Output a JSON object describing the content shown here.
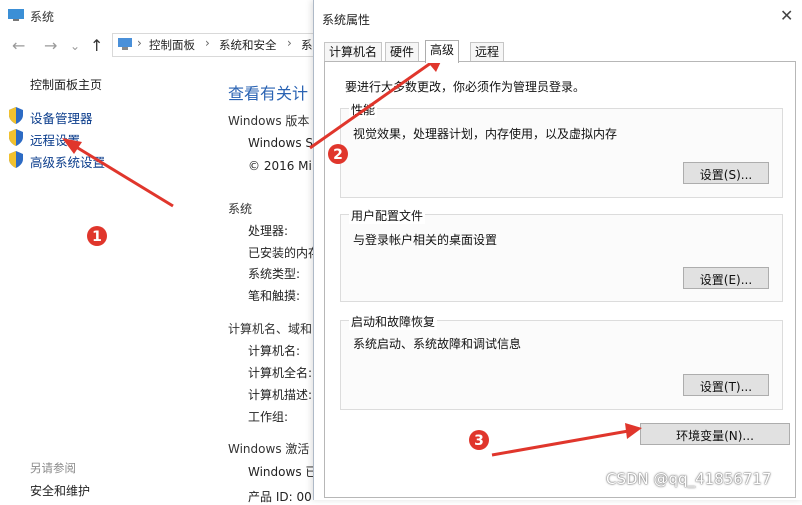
{
  "background_window": {
    "title": "系统",
    "breadcrumb": [
      "控制面板",
      "系统和安全",
      "系"
    ],
    "left_panel": {
      "home": "控制面板主页",
      "links": [
        "设备管理器",
        "远程设置",
        "高级系统设置"
      ],
      "see_also": "另请参阅",
      "security": "安全和维护"
    },
    "main": {
      "heading": "查看有关计",
      "windows_edition": "Windows 版本",
      "windows_name": "Windows S",
      "copyright": "© 2016 Mi",
      "system_section": "系统",
      "system_rows": [
        "处理器:",
        "已安装的内存",
        "系统类型:",
        "笔和触摸:"
      ],
      "computer_section": "计算机名、域和",
      "computer_rows": [
        "计算机名:",
        "计算机全名:",
        "计算机描述:",
        "工作组:"
      ],
      "activation_section": "Windows 激活",
      "activation_row": "Windows 已",
      "product_id": "产品 ID: 00"
    }
  },
  "dialog": {
    "title": "系统属性",
    "close": "✕",
    "tabs": [
      "计算机名",
      "硬件",
      "高级",
      "远程"
    ],
    "selected_tab": "高级",
    "admin_note": "要进行大多数更改，你必须作为管理员登录。",
    "groups": [
      {
        "title": "性能",
        "desc": "视觉效果，处理器计划，内存使用，以及虚拟内存",
        "button": "设置(S)..."
      },
      {
        "title": "用户配置文件",
        "desc": "与登录帐户相关的桌面设置",
        "button": "设置(E)..."
      },
      {
        "title": "启动和故障恢复",
        "desc": "系统启动、系统故障和调试信息",
        "button": "设置(T)..."
      }
    ],
    "env_button": "环境变量(N)..."
  },
  "annotations": {
    "badges": [
      "1",
      "2",
      "3"
    ],
    "color": "#e0362c"
  },
  "watermark": "CSDN @qq_41856717",
  "colors": {
    "link": "#0b3d8c",
    "heading": "#2a63b3",
    "arrow": "#e0362c"
  }
}
